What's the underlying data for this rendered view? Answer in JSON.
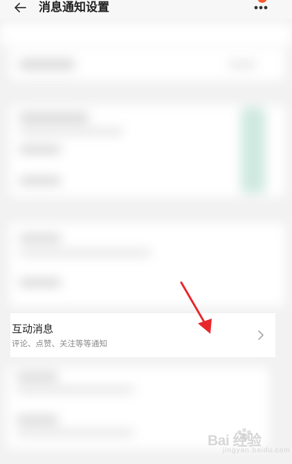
{
  "header": {
    "title": "消息通知设置",
    "back_icon": "back-arrow-icon",
    "more_icon": "more-dots-icon",
    "badge_color": "#f25a2f"
  },
  "focused_row": {
    "title": "互动消息",
    "subtitle": "评论、点赞、关注等等通知",
    "chevron_icon": "chevron-right-icon"
  },
  "annotation": {
    "arrow_icon": "red-arrow-icon",
    "color": "#e8262c"
  },
  "watermark": {
    "text": "Bai 经验",
    "url_text": "jingyan.baidu.com",
    "logo_icon": "paw-icon"
  }
}
